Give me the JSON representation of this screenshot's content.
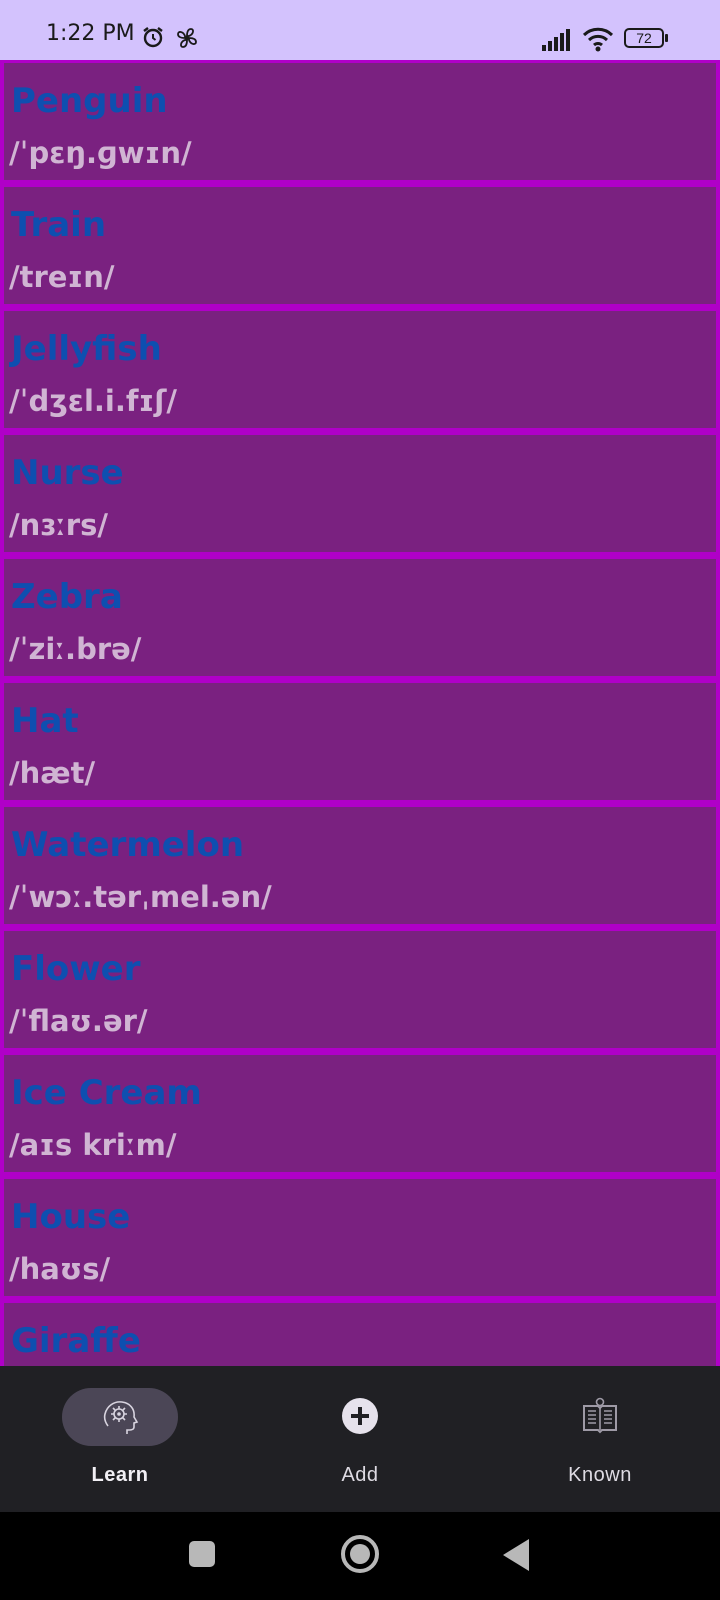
{
  "status_bar": {
    "time": "1:22 PM",
    "battery": "72",
    "icons": [
      "alarm-icon",
      "fan-icon",
      "signal-icon",
      "wifi-icon",
      "battery-icon"
    ]
  },
  "words": [
    {
      "word": "Penguin",
      "ipa": "/ˈpɛŋ.ɡwɪn/"
    },
    {
      "word": "Train",
      "ipa": "/treɪn/"
    },
    {
      "word": "Jellyfish",
      "ipa": "/ˈdʒɛl.i.fɪʃ/"
    },
    {
      "word": "Nurse",
      "ipa": "/nɜːrs/"
    },
    {
      "word": "Zebra",
      "ipa": "/ˈziː.brə/"
    },
    {
      "word": "Hat",
      "ipa": "/hæt/"
    },
    {
      "word": "Watermelon",
      "ipa": "/ˈwɔː.tərˌmel.ən/"
    },
    {
      "word": "Flower",
      "ipa": "/ˈflaʊ.ər/"
    },
    {
      "word": "Ice Cream",
      "ipa": "/aɪs kriːm/"
    },
    {
      "word": "House",
      "ipa": "/haʊs/"
    },
    {
      "word": "Giraffe",
      "ipa": ""
    }
  ],
  "bottom_nav": {
    "items": [
      {
        "label": "Learn",
        "icon": "brain-gear-icon",
        "active": true
      },
      {
        "label": "Add",
        "icon": "add-circle-icon",
        "active": false
      },
      {
        "label": "Known",
        "icon": "open-book-icon",
        "active": false
      }
    ]
  },
  "colors": {
    "card_bg": "#7a2180",
    "card_border": "#b000c8",
    "word_text": "#0e4fb0",
    "ipa_text": "#d0b5d3",
    "status_bar_bg": "#d3c2fd",
    "nav_bg": "#202024"
  }
}
